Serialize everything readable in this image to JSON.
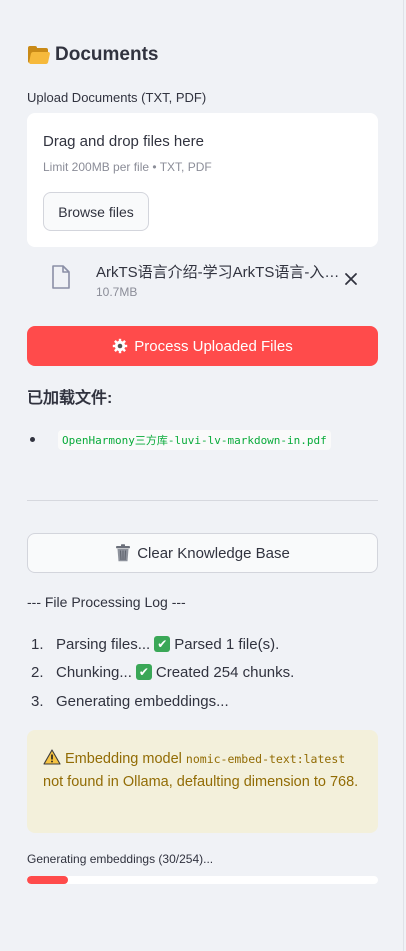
{
  "sidebar": {
    "title": "Documents",
    "upload": {
      "label": "Upload Documents (TXT, PDF)",
      "drag_text": "Drag and drop files here",
      "limit_text": "Limit 200MB per file • TXT, PDF",
      "browse_label": "Browse files"
    },
    "uploaded_file": {
      "name": "ArkTS语言介绍-学习ArkTS语言-入…",
      "size": "10.7MB"
    },
    "process_button_label": "Process Uploaded Files",
    "loaded_files": {
      "title": "已加载文件:",
      "items": [
        "OpenHarmony三方库-luvi-lv-markdown-in.pdf"
      ]
    },
    "clear_button_label": "Clear Knowledge Base",
    "log": {
      "title": "--- File Processing Log ---",
      "items": [
        {
          "num": "1.",
          "pre": "Parsing files...",
          "check": true,
          "post": "Parsed 1 file(s)."
        },
        {
          "num": "2.",
          "pre": "Chunking...",
          "check": true,
          "post": "Created 254 chunks."
        },
        {
          "num": "3.",
          "pre": "Generating embeddings...",
          "check": false,
          "post": ""
        }
      ]
    },
    "warning": {
      "prefix": "Embedding model",
      "model": "nomic-embed-text:latest",
      "suffix": "not found in Ollama, defaulting dimension to 768."
    },
    "progress": {
      "label": "Generating embeddings (30/254)...",
      "done": 30,
      "total": 254
    }
  },
  "colors": {
    "primary": "#ff4b4b",
    "background": "#f0f2f6",
    "success": "#09ab3b",
    "warning_text": "#926c05",
    "warning_bg": "#f3f0db"
  }
}
